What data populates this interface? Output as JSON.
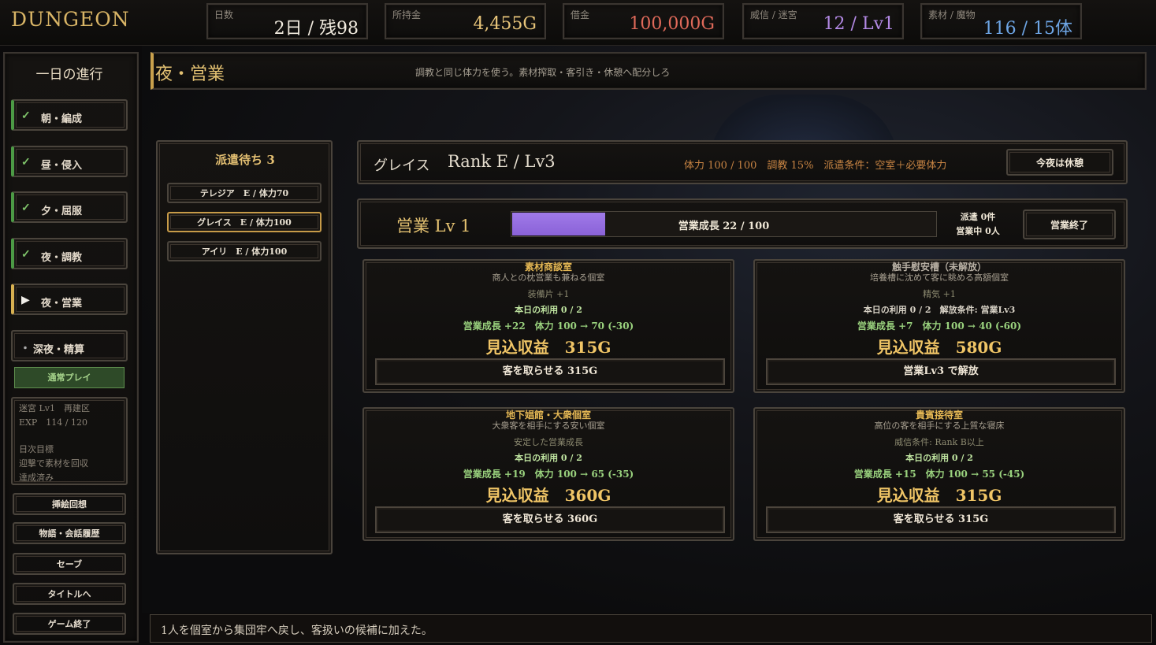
{
  "header": {
    "title": "DUNGEON",
    "stats": [
      {
        "label": "日数",
        "value": "2日 / 残98",
        "color": "#f2ece0"
      },
      {
        "label": "所持金",
        "value": "4,455G",
        "color": "#e8c57a"
      },
      {
        "label": "借金",
        "value": "100,000G",
        "color": "#e06a5a"
      },
      {
        "label": "威信 / 迷宮",
        "value": "12 / Lv1",
        "color": "#b48ae6"
      },
      {
        "label": "素材 / 魔物",
        "value": "116 / 15体",
        "color": "#6ea6e6"
      }
    ]
  },
  "sidebar": {
    "heading": "一日の進行",
    "steps": [
      {
        "label": "朝・編成",
        "mark": "✓",
        "state": "done"
      },
      {
        "label": "昼・侵入",
        "mark": "✓",
        "state": "done"
      },
      {
        "label": "夕・屈服",
        "mark": "✓",
        "state": "done"
      },
      {
        "label": "夜・調教",
        "mark": "✓",
        "state": "done"
      },
      {
        "label": "夜・営業",
        "mark": "▶",
        "state": "current"
      },
      {
        "label": "深夜・精算",
        "mark": "・",
        "state": "pending"
      }
    ],
    "mode": "通常プレイ",
    "info": {
      "line1": "迷宮 Lv1　再建区",
      "line2": "EXP　114 / 120",
      "line3": "日次目標",
      "line4": "迎撃で素材を回収",
      "line5": "達成済み"
    },
    "buttons": [
      "挿絵回想",
      "物語・会話履歴",
      "セーブ",
      "タイトルへ",
      "ゲーム終了"
    ]
  },
  "phase": {
    "title": "夜・営業",
    "subtitle": "調教と同じ体力を使う。素材搾取・客引き・休憩へ配分しろ"
  },
  "queue": {
    "title": "派遣待ち 3",
    "items": [
      {
        "label": "テレジア　E / 体力70",
        "selected": false
      },
      {
        "label": "グレイス　E / 体力100",
        "selected": true
      },
      {
        "label": "アイリ　E / 体力100",
        "selected": false
      }
    ]
  },
  "character": {
    "name": "グレイス",
    "rank": "Rank E / Lv3",
    "stats": "体力 100 / 100　調教 15%　派遣条件：空室＋必要体力",
    "rest_button": "今夜は休憩"
  },
  "business": {
    "level": "営業 Lv 1",
    "progress": 0.22,
    "progress_text": "営業成長 22 / 100",
    "dispatch_line1": "派遣 0件",
    "dispatch_line2": "営業中 0人",
    "end_button": "営業終了"
  },
  "rooms": [
    {
      "name": "素材商談室",
      "desc": "商人との枕営業も兼ねる個室",
      "note": "装備片 +1",
      "usage": "本日の利用 0 / 2",
      "growth": "営業成長 +22　体力 100 → 70 (-30)",
      "revenue": "見込収益　315G",
      "button": "客を取らせる 315G"
    },
    {
      "name": "触手慰安槽（未解放）",
      "desc": "培養槽に沈めて客に眺める高額個室",
      "note": "精気 +1",
      "usage": "本日の利用 0 / 2　解放条件: 営業Lv3",
      "growth": "営業成長 +7　体力 100 → 40 (-60)",
      "revenue": "見込収益　580G",
      "button": "営業Lv3 で解放"
    },
    {
      "name": "地下娼館・大衆個室",
      "desc": "大衆客を相手にする安い個室",
      "note": "安定した営業成長",
      "usage": "本日の利用 0 / 2",
      "growth": "営業成長 +19　体力 100 → 65 (-35)",
      "revenue": "見込収益　360G",
      "button": "客を取らせる 360G"
    },
    {
      "name": "貴賓接待室",
      "desc": "高位の客を相手にする上質な寝床",
      "note": "威信条件: Rank B以上",
      "usage": "本日の利用 0 / 2",
      "growth": "営業成長 +15　体力 100 → 55 (-45)",
      "revenue": "見込収益　315G",
      "button": "客を取らせる 315G"
    }
  ],
  "log": "1人を個室から集団牢へ戻し、客扱いの候補に加えた。"
}
